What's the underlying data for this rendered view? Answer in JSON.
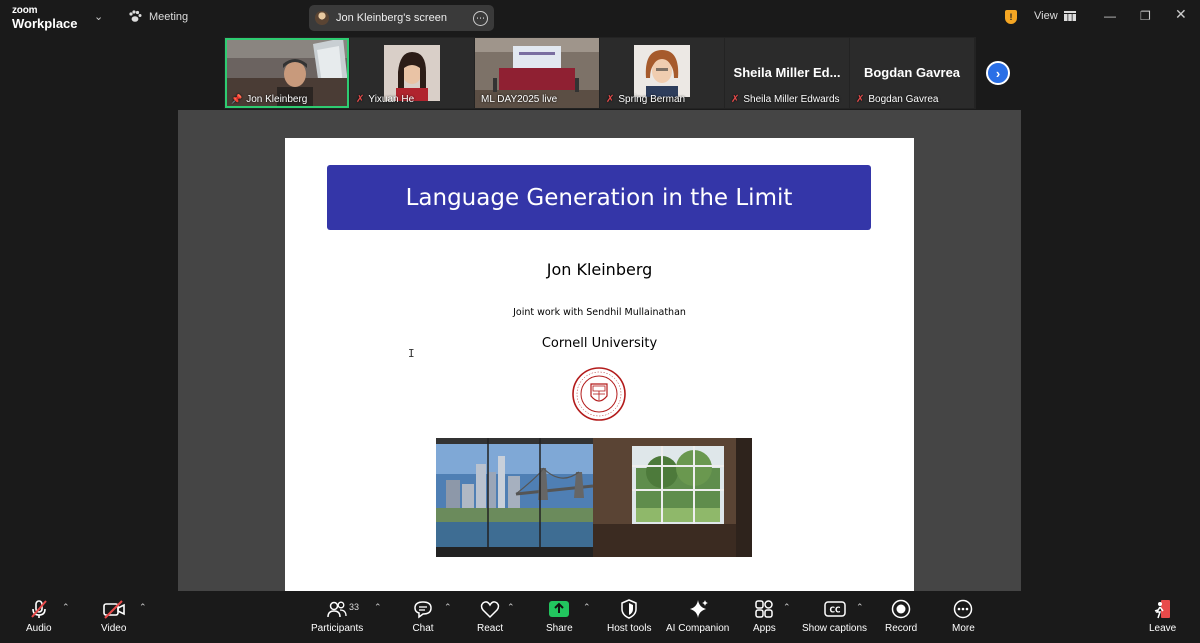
{
  "app": {
    "logo_line1": "zoom",
    "logo_line2": "Workplace",
    "meeting_label": "Meeting",
    "share_pill_text": "Jon Kleinberg's screen",
    "view_label": "View"
  },
  "gallery": {
    "tiles": [
      {
        "name": "Jon Kleinberg",
        "muted": false,
        "active": true
      },
      {
        "name": "Yixuan He",
        "muted": true
      },
      {
        "name": "ML DAY2025 live",
        "muted": false
      },
      {
        "name": "Spring Berman",
        "muted": true
      },
      {
        "name": "Sheila Miller Edwards",
        "big_name": "Sheila Miller Ed...",
        "muted": true
      },
      {
        "name": "Bogdan Gavrea",
        "big_name": "Bogdan Gavrea",
        "muted": true
      }
    ]
  },
  "slide": {
    "title": "Language Generation in the Limit",
    "author": "Jon Kleinberg",
    "joint": "Joint work with Sendhil Mullainathan",
    "university": "Cornell University"
  },
  "toolbar": {
    "audio": "Audio",
    "video": "Video",
    "participants": "Participants",
    "participants_count": "33",
    "chat": "Chat",
    "react": "React",
    "share": "Share",
    "host_tools": "Host tools",
    "ai_companion": "AI Companion",
    "apps": "Apps",
    "show_captions": "Show captions",
    "record": "Record",
    "more": "More",
    "leave": "Leave"
  },
  "colors": {
    "accent_green": "#2ecc71",
    "share_green": "#22c55e",
    "mute_red": "#e84a4a",
    "slide_title_bg": "#3436a8",
    "cornell_red": "#b31b1b"
  }
}
